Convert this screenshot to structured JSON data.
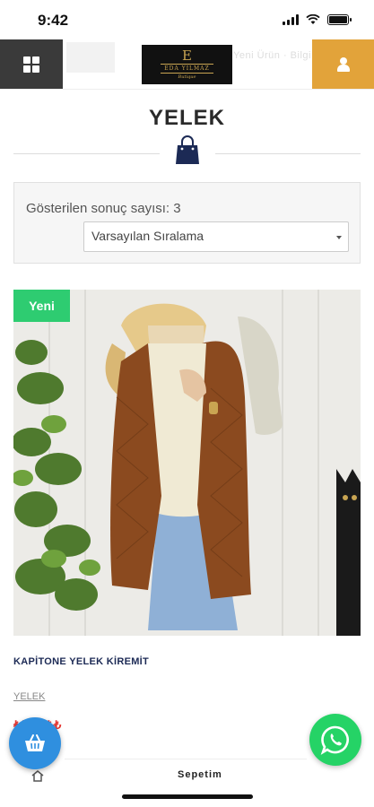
{
  "status_bar": {
    "time": "9:42"
  },
  "header": {
    "logo_mark": "E",
    "logo_name": "EDA YILMAZ",
    "logo_sub": "Butique",
    "ghost_text": "Yeni Ürün · Bilgi"
  },
  "page": {
    "title": "YELEK"
  },
  "filter": {
    "result_count": "Gösterilen sonuç sayısı: 3",
    "sort_selected": "Varsayılan Sıralama"
  },
  "product": {
    "badge": "Yeni",
    "name": "KAPİTONE YELEK KİREMİT",
    "category": "YELEK",
    "price": "₺₺₺,₺₺₺"
  },
  "bottom_bar": {
    "label": "Sepetim"
  },
  "colors": {
    "menu_bg": "#3a3a3a",
    "user_bg": "#e2a33a",
    "badge_bg": "#2ecc71",
    "price": "#e53935",
    "cart_fab": "#2f8fdf",
    "whatsapp": "#25d366",
    "title_navy": "#1c2a55"
  },
  "icons": [
    "grid-menu-icon",
    "user-icon",
    "shopping-bag-icon",
    "basket-icon",
    "whatsapp-icon",
    "dropdown-caret-icon"
  ]
}
